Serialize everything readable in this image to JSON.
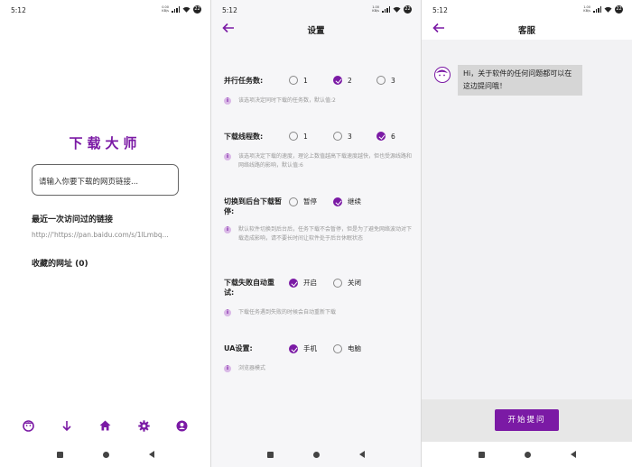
{
  "statusbar": {
    "time": "5:12",
    "net_speed_1": "0.00 KB/s",
    "net_speed_2": "1.00 KB/s",
    "net_speed_3": "1.00 KB/s",
    "battery": "22"
  },
  "home": {
    "title": "下载大师",
    "input_placeholder": "请输入你要下载的网页链接...",
    "recent_heading": "最近一次访问过的链接",
    "recent_link": "http://'https://pan.baidu.com/s/1lLmbq...",
    "favorites_label": "收藏的网址",
    "favorites_count": "(0)",
    "tabs": [
      {
        "name": "face-icon"
      },
      {
        "name": "download-arrow-icon"
      },
      {
        "name": "home-icon"
      },
      {
        "name": "gear-icon"
      },
      {
        "name": "account-icon"
      }
    ]
  },
  "settings": {
    "title": "设置",
    "parallel": {
      "label": "并行任务数:",
      "options": [
        "1",
        "2",
        "3"
      ],
      "selected": "2",
      "hint": "该选项决定同时下载的任务数，默认值:2"
    },
    "threads": {
      "label": "下载线程数:",
      "options": [
        "1",
        "3",
        "6"
      ],
      "selected": "6",
      "hint": "该选项决定下载的速度，理论上数值越高下载速度越快，但也受源线路和网络线路的影响，默认值:6"
    },
    "background": {
      "label_line1": "切换到后台下载暂",
      "label_line2": "停:",
      "options": [
        "暂停",
        "继续"
      ],
      "selected": "继续",
      "hint": "默认软件切换到后台后，任务下载不会暂停，但是为了避免网络波动对下载造成影响，请不要长时间让软件处于后台休眠状态"
    },
    "retry": {
      "label_line1": "下载失败自动重",
      "label_line2": "试:",
      "options": [
        "开启",
        "关闭"
      ],
      "selected": "开启",
      "hint": "下载任务遇到失败的时候会自动重新下载"
    },
    "ua": {
      "label": "UA设置:",
      "options": [
        "手机",
        "电脑"
      ],
      "selected": "手机",
      "hint": "浏览器模式"
    }
  },
  "support": {
    "title": "客服",
    "message": "Hi，关于软件的任何问题都可以在这边提问哦！",
    "ask_button": "开始提问"
  },
  "colors": {
    "accent": "#7b1aa5",
    "bubble": "#d6d6d6"
  }
}
